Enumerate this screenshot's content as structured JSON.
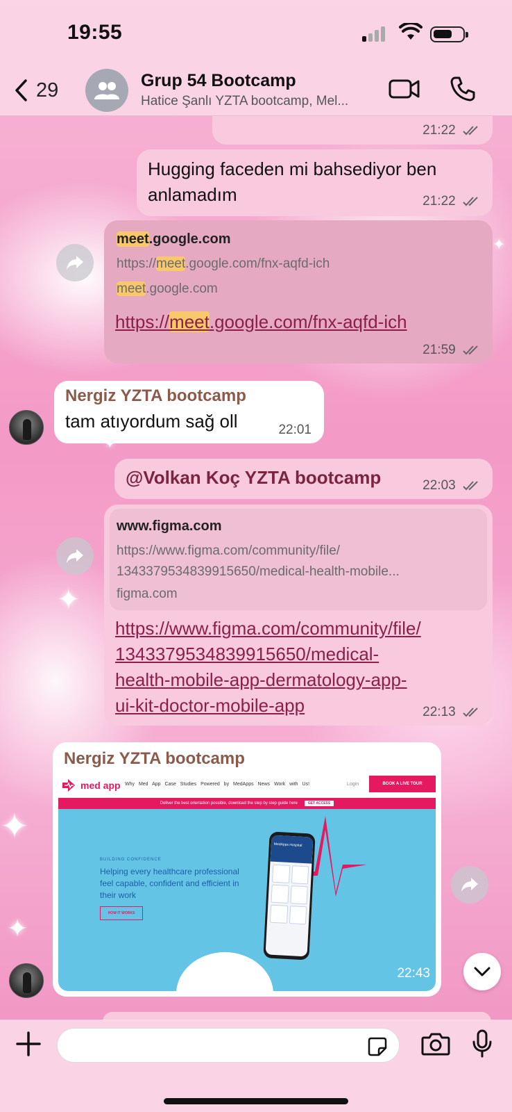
{
  "status": {
    "time": "19:55"
  },
  "header": {
    "back_count": "29",
    "title": "Grup 54 Bootcamp",
    "subtitle": "Hatice Şanlı YZTA bootcamp, Mel..."
  },
  "messages": [
    {
      "type": "out_text_partial",
      "time": "21:22"
    },
    {
      "type": "out_text",
      "text": "Hugging faceden mi bahsediyor ben anlamadım",
      "time": "21:22"
    },
    {
      "type": "out_link",
      "preview_title": "meet.google.com",
      "preview_url": "https://meet.google.com/fnx-aqfd-ich",
      "preview_domain": "meet.google.com",
      "link": "https://meet.google.com/fnx-aqfd-ich",
      "highlight": "meet",
      "time": "21:59"
    },
    {
      "type": "in_text",
      "sender": "Nergiz YZTA bootcamp",
      "text": "tam atıyordum sağ oll",
      "time": "22:01"
    },
    {
      "type": "out_mention",
      "text": "@Volkan Koç YZTA bootcamp",
      "time": "22:03"
    },
    {
      "type": "out_link",
      "preview_title": "www.figma.com",
      "preview_url_line1": "https://www.figma.com/community/file/",
      "preview_url_line2": "1343379534839915650/medical-health-mobile...",
      "preview_domain": "figma.com",
      "link_lines": [
        "https://www.figma.com/community/file/",
        "1343379534839915650/medical-",
        "health-mobile-app-dermatology-app-",
        "ui-kit-doctor-mobile-app"
      ],
      "time": "22:13"
    },
    {
      "type": "in_image",
      "sender": "Nergiz YZTA bootcamp",
      "time": "22:43",
      "image": {
        "brand": "med app",
        "menu": "Why Med App   Case Studies   Powered by MedApps   News   Work with Us!",
        "login": "Login",
        "cta": "BOOK A LIVE TOUR",
        "banner": "Deliver the best orientation possible, download the step by step guide here",
        "banner_btn": "GET ACCESS",
        "kicker": "BUILDING CONFIDENCE",
        "headline": "Helping every healthcare professional feel capable, confident and efficient in their work",
        "button": "HOW IT WORKS",
        "phone_title": "MedApps Hospital"
      }
    }
  ],
  "composer": {
    "placeholder": ""
  },
  "colors": {
    "outgoing": "#f9c9de",
    "incoming": "#ffffff",
    "link": "#8a1f4a",
    "brand": "#e5195f"
  }
}
